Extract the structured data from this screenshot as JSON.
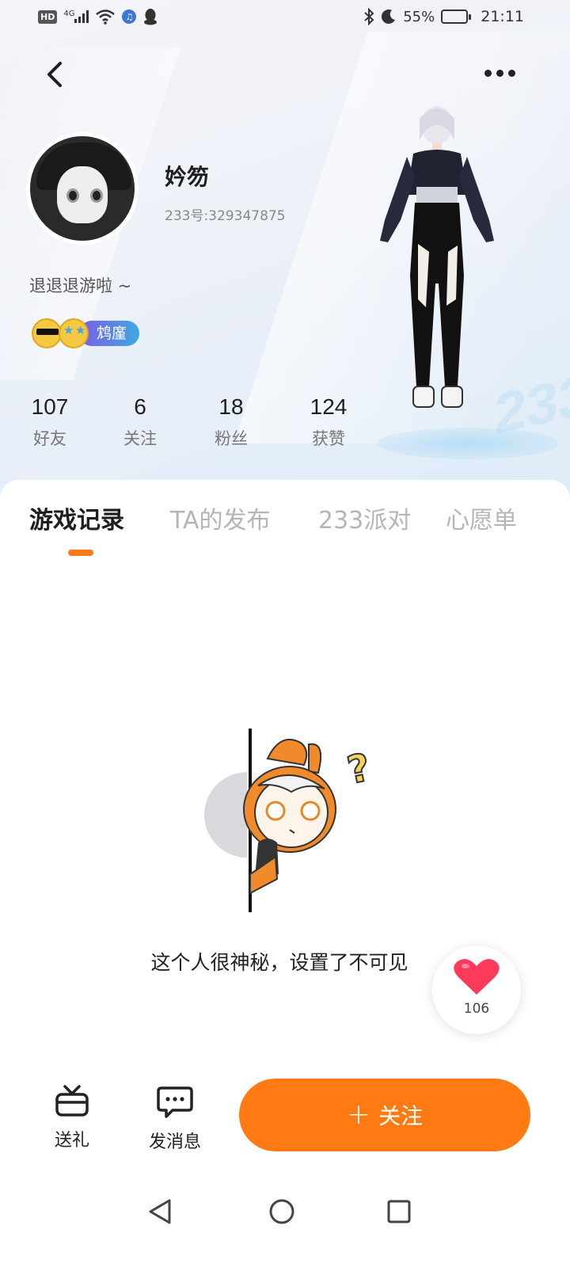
{
  "status_bar": {
    "hd": "HD",
    "network": "4G",
    "battery_percent": "55%",
    "time": "21:11",
    "battery_level": 0.55
  },
  "profile": {
    "username": "妗笏",
    "user_id": "233号:329347875",
    "bio": "退退退游啦 ~",
    "badge_label": "鸩廑"
  },
  "stats": [
    {
      "value": "107",
      "label": "好友"
    },
    {
      "value": "6",
      "label": "关注"
    },
    {
      "value": "18",
      "label": "粉丝"
    },
    {
      "value": "124",
      "label": "获赞"
    }
  ],
  "decor_text": "233",
  "tabs": [
    {
      "label": "游戏记录",
      "active": true
    },
    {
      "label": "TA的发布",
      "active": false
    },
    {
      "label": "233派对",
      "active": false
    },
    {
      "label": "心愿单",
      "active": false
    }
  ],
  "empty_state": {
    "message": "这个人很神秘，设置了不可见",
    "question_mark": "?"
  },
  "like_float": {
    "count": "106"
  },
  "actions": {
    "gift_label": "送礼",
    "message_label": "发消息",
    "follow_label": "关注",
    "follow_plus": "+"
  },
  "colors": {
    "accent": "#ff7a12",
    "badge_gradient_start": "#7b5ce8",
    "badge_gradient_end": "#3fa9e0",
    "heart": "#ff3b5c"
  }
}
